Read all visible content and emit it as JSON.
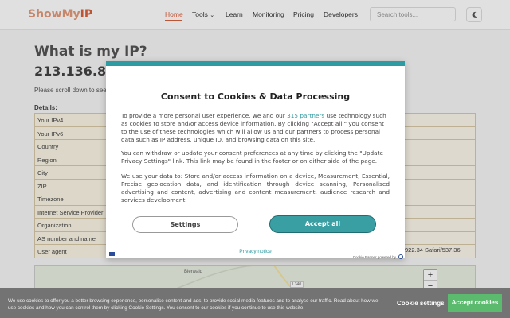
{
  "header": {
    "logo_part1": "ShowMy",
    "logo_part2": "IP",
    "nav": [
      "Home",
      "Tools",
      "Learn",
      "Monitoring",
      "Pricing",
      "Developers"
    ],
    "search_placeholder": "Search tools...",
    "theme_icon": "moon-icon"
  },
  "main": {
    "title": "What is my IP?",
    "ip": "213.136.84.4",
    "scroll_note": "Please scroll down to see",
    "details_label": "Details:",
    "rows": [
      {
        "key": "Your IPv4",
        "value": ""
      },
      {
        "key": "Your IPv6",
        "value": ""
      },
      {
        "key": "Country",
        "value": ""
      },
      {
        "key": "Region",
        "value": ""
      },
      {
        "key": "City",
        "value": ""
      },
      {
        "key": "ZIP",
        "value": ""
      },
      {
        "key": "Timezone",
        "value": ""
      },
      {
        "key": "Internet Service Provider",
        "value": ""
      },
      {
        "key": "Organization",
        "value": ""
      },
      {
        "key": "AS number and name",
        "value": ""
      },
      {
        "key": "User agent",
        "value": ""
      }
    ],
    "agent_tail": "922.34 Safari/537.36"
  },
  "map": {
    "place_label": "Bierwald",
    "road_label": "L340",
    "zoom_in": "+",
    "zoom_out": "−"
  },
  "modal": {
    "title": "Consent to Cookies & Data Processing",
    "p1_before": "To provide a more personal user experience, we and our ",
    "p1_link": "315 partners",
    "p1_after": " use technology such as cookies to store and/or access device information. By clicking \"Accept all,\" you consent to the use of these technologies which will allow us and our partners to process personal data such as IP address, unique ID, and browsing data on this site.",
    "p2": "You can withdraw or update your consent preferences at any time by clicking the \"Update Privacy Settings\" link. This link may be found in the footer or on either side of the page.",
    "p3": "We use your data to: Store and/or access information on a device, Measurement, Essential, Precise geolocation data, and identification through device scanning, Personalised advertising and content, advertising and content measurement, audience research and services development",
    "settings_label": "Settings",
    "accept_label": "Accept all",
    "privacy_label": "Privacy notice",
    "powered_label": "Cookie Banner powered by"
  },
  "cookie_bar": {
    "text": "We use cookies to offer you a better browsing experience, personalise content and ads, to provide social media features and to analyse our traffic. Read about how we use cookies and how you can control them by clicking Cookie Settings. You consent to our cookies if you continue to use this website.",
    "settings_label": "Cookie settings",
    "accept_label": "Accept cookies"
  },
  "colors": {
    "brand": "#d9603c",
    "teal": "#2e9aa1",
    "accept_green": "#5cba6e"
  }
}
